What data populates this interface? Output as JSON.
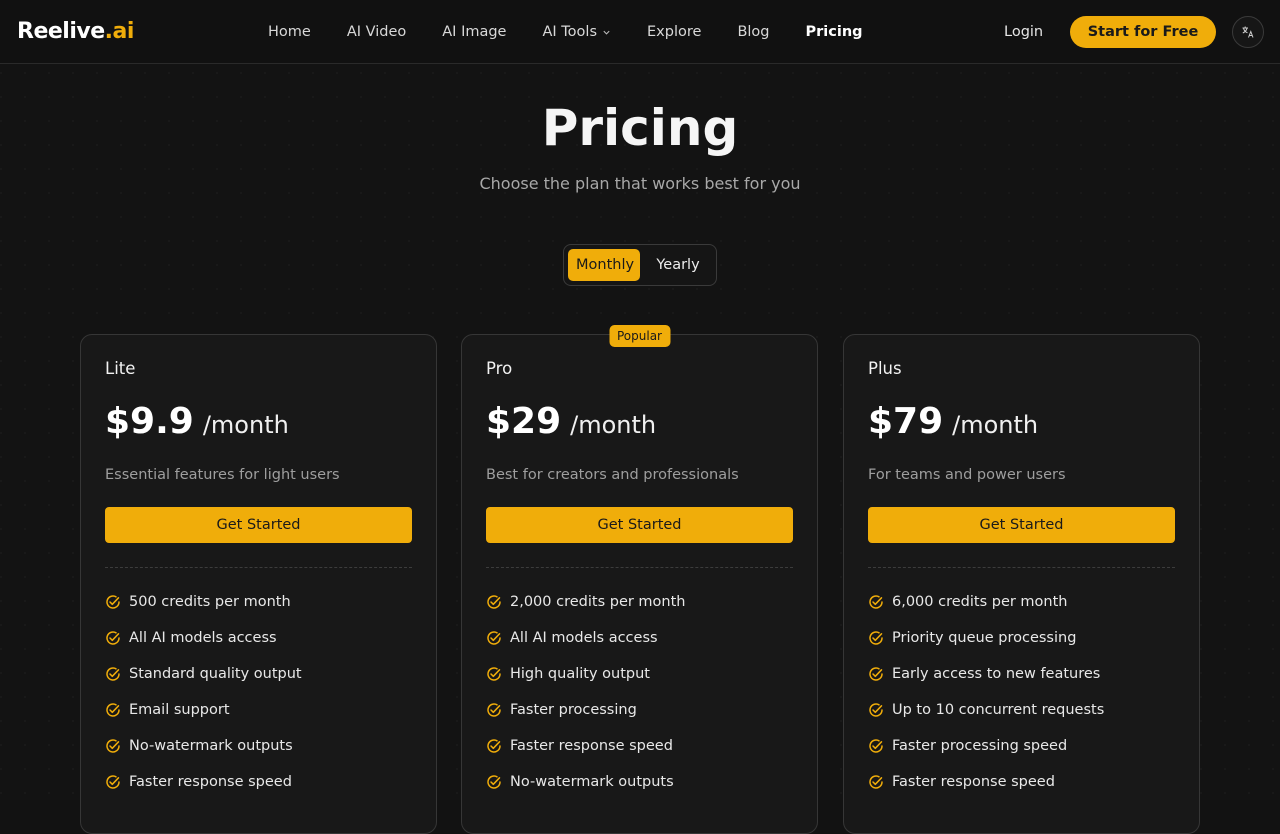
{
  "nav": {
    "logo_main": "Reelive",
    "logo_accent": ".ai",
    "links": [
      {
        "label": "Home"
      },
      {
        "label": "AI Video"
      },
      {
        "label": "AI Image"
      },
      {
        "label": "AI Tools"
      },
      {
        "label": "Explore"
      },
      {
        "label": "Blog"
      },
      {
        "label": "Pricing"
      }
    ],
    "login": "Login",
    "cta": "Start for Free",
    "language_icon": "translate-icon"
  },
  "header": {
    "title": "Pricing",
    "subtitle": "Choose the plan that works best for you"
  },
  "billing_toggle": {
    "monthly": "Monthly",
    "yearly": "Yearly",
    "selected": "Monthly"
  },
  "plans": [
    {
      "name": "Lite",
      "price": "$9.9",
      "period": "/month",
      "description": "Essential features for light users",
      "button": "Get Started",
      "features": [
        "500 credits per month",
        "All AI models access",
        "Standard quality output",
        "Email support",
        "No-watermark outputs",
        "Faster response speed"
      ]
    },
    {
      "name": "Pro",
      "badge": "Popular",
      "price": "$29",
      "period": "/month",
      "description": "Best for creators and professionals",
      "button": "Get Started",
      "features": [
        "2,000 credits per month",
        "All AI models access",
        "High quality output",
        "Faster processing",
        "Faster response speed",
        "No-watermark outputs"
      ]
    },
    {
      "name": "Plus",
      "price": "$79",
      "period": "/month",
      "description": "For teams and power users",
      "button": "Get Started",
      "features": [
        "6,000 credits per month",
        "Priority queue processing",
        "Early access to new features",
        "Up to 10 concurrent requests",
        "Faster processing speed",
        "Faster response speed"
      ]
    }
  ],
  "colors": {
    "accent": "#f0ad0a",
    "background": "#131313",
    "card": "#181818"
  }
}
